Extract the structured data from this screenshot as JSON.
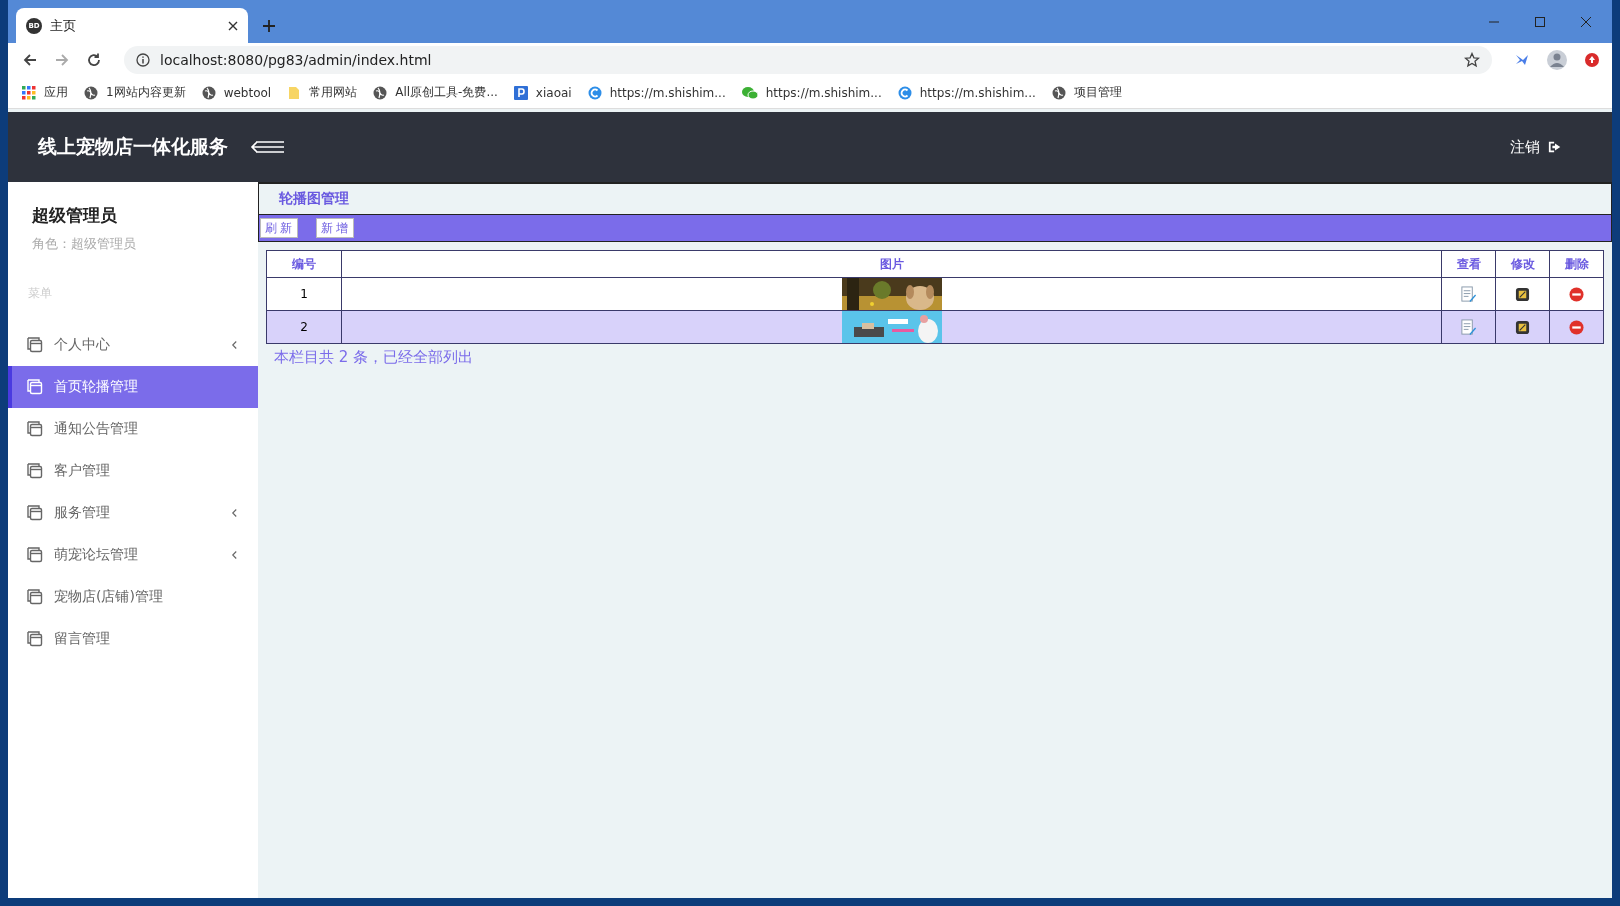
{
  "browser": {
    "tab": {
      "favicon_text": "BD",
      "title": "主页"
    },
    "address": "localhost:8080/pg83/admin/index.html",
    "bookmarks": [
      {
        "kind": "apps",
        "label": "应用"
      },
      {
        "kind": "globe",
        "label": "1网站内容更新"
      },
      {
        "kind": "globe",
        "label": "webtool"
      },
      {
        "kind": "folder",
        "label": "常用网站"
      },
      {
        "kind": "globe",
        "label": "All原创工具-免费..."
      },
      {
        "kind": "p",
        "label": "xiaoai"
      },
      {
        "kind": "c",
        "label": "https://m.shishim..."
      },
      {
        "kind": "chat",
        "label": "https://m.shishim..."
      },
      {
        "kind": "c",
        "label": "https://m.shishim..."
      },
      {
        "kind": "globe",
        "label": "项目管理"
      }
    ]
  },
  "header": {
    "title": "线上宠物店一体化服务",
    "logout": "注销"
  },
  "sidebar": {
    "user": "超级管理员",
    "role": "角色：超级管理员",
    "menu_heading": "菜单",
    "items": [
      {
        "label": "个人中心",
        "selected": false,
        "has_children": true
      },
      {
        "label": "首页轮播管理",
        "selected": true,
        "has_children": false
      },
      {
        "label": "通知公告管理",
        "selected": false,
        "has_children": false
      },
      {
        "label": "客户管理",
        "selected": false,
        "has_children": false
      },
      {
        "label": "服务管理",
        "selected": false,
        "has_children": true
      },
      {
        "label": "萌宠论坛管理",
        "selected": false,
        "has_children": true
      },
      {
        "label": "宠物店(店铺)管理",
        "selected": false,
        "has_children": false
      },
      {
        "label": "留言管理",
        "selected": false,
        "has_children": false
      }
    ]
  },
  "content": {
    "title": "轮播图管理",
    "buttons": [
      "刷新",
      "新增"
    ],
    "table": {
      "columns": [
        "编号",
        "图片",
        "查看",
        "修改",
        "删除"
      ],
      "rows": [
        {
          "id": "1",
          "selected": false
        },
        {
          "id": "2",
          "selected": true
        }
      ]
    },
    "summary": "本栏目共 2 条，已经全部列出"
  }
}
